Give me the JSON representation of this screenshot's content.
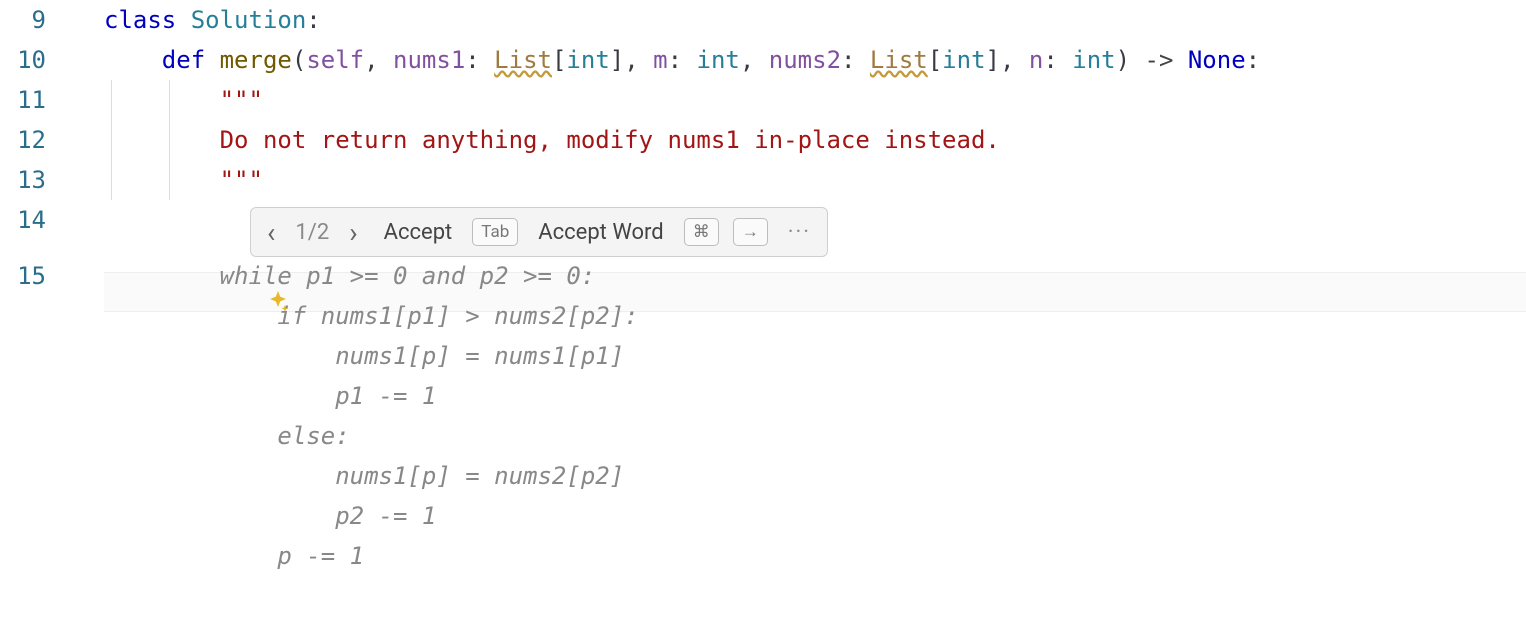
{
  "gutter": {
    "line9": "9",
    "line10": "10",
    "line11": "11",
    "line12": "12",
    "line13": "13",
    "line14": "14",
    "line15": "15"
  },
  "code": {
    "class_kw": "class",
    "space": " ",
    "class_name": "Solution",
    "colon": ":",
    "def_kw": "def",
    "fn_name": "merge",
    "paren_open": "(",
    "self": "self",
    "comma_sp": ", ",
    "arg_nums1": "nums1",
    "ann_colon_sp": ": ",
    "type_list": "List",
    "brkt_open": "[",
    "type_int": "int",
    "brkt_close": "]",
    "arg_m": "m",
    "arg_nums2": "nums2",
    "arg_n": "n",
    "paren_close": ")",
    "arrow_sp": " -> ",
    "none": "None",
    "docq1": "\"\"\"",
    "docline": "Do not return anything, modify nums1 in-place instead.",
    "docq2": "\"\"\""
  },
  "ghost": {
    "l1": "while p1 >= 0 and p2 >= 0:",
    "l2": "if nums1[p1] > nums2[p2]:",
    "l3": "nums1[p] = nums1[p1]",
    "l4": "p1 -= 1",
    "l5": "else:",
    "l6": "nums1[p] = nums2[p2]",
    "l7": "p2 -= 1",
    "l8": "p -= 1"
  },
  "toolbar": {
    "count": "1/2",
    "accept": "Accept",
    "accept_key": "Tab",
    "accept_word": "Accept Word",
    "cmd_key": "⌘",
    "arrow_key": "→",
    "more": "···"
  },
  "icons": {
    "sparkle": "sparkle-icon",
    "chev_left": "‹",
    "chev_right": "›"
  }
}
